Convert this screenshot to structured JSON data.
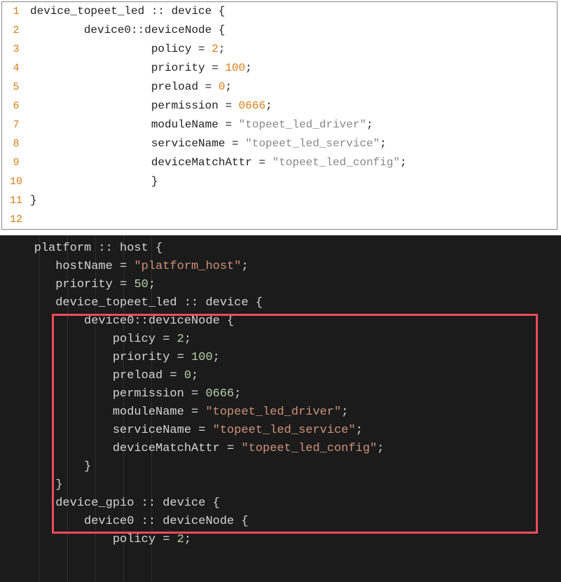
{
  "light": {
    "gutter": [
      "1",
      "2",
      "3",
      "4",
      "5",
      "6",
      "7",
      "8",
      "9",
      "10",
      "11",
      "12"
    ],
    "lines": [
      [
        {
          "t": "device_topeet_led :: device {"
        }
      ],
      [
        {
          "t": "        device0::deviceNode {"
        }
      ],
      [
        {
          "t": "                  policy = "
        },
        {
          "t": "2",
          "c": "num"
        },
        {
          "t": ";"
        }
      ],
      [
        {
          "t": "                  priority = "
        },
        {
          "t": "100",
          "c": "num"
        },
        {
          "t": ";"
        }
      ],
      [
        {
          "t": "                  preload = "
        },
        {
          "t": "0",
          "c": "num"
        },
        {
          "t": ";"
        }
      ],
      [
        {
          "t": "                  permission = "
        },
        {
          "t": "0666",
          "c": "num"
        },
        {
          "t": ";"
        }
      ],
      [
        {
          "t": "                  moduleName = "
        },
        {
          "t": "\"topeet_led_driver\"",
          "c": "str"
        },
        {
          "t": ";"
        }
      ],
      [
        {
          "t": "                  serviceName = "
        },
        {
          "t": "\"topeet_led_service\"",
          "c": "str"
        },
        {
          "t": ";"
        }
      ],
      [
        {
          "t": "                  deviceMatchAttr = "
        },
        {
          "t": "\"topeet_led_config\"",
          "c": "str"
        },
        {
          "t": ";"
        }
      ],
      [
        {
          "t": ""
        }
      ],
      [
        {
          "t": "                  }"
        }
      ],
      [
        {
          "t": "}"
        }
      ]
    ]
  },
  "dark": {
    "rulers": [
      56,
      96,
      136,
      176,
      216
    ],
    "lines": [
      [
        {
          "t": "   platform :: host {"
        }
      ],
      [
        {
          "t": "      hostName = "
        },
        {
          "t": "\"platform_host\"",
          "c": "dstr"
        },
        {
          "t": ";"
        }
      ],
      [
        {
          "t": "      priority = "
        },
        {
          "t": "50",
          "c": "dnum"
        },
        {
          "t": ";"
        }
      ],
      [
        {
          "t": ""
        }
      ],
      [
        {
          "t": "      device_topeet_led :: device {"
        }
      ],
      [
        {
          "t": "          device0::deviceNode {"
        }
      ],
      [
        {
          "t": "              policy = "
        },
        {
          "t": "2",
          "c": "dnum"
        },
        {
          "t": ";"
        }
      ],
      [
        {
          "t": "              priority = "
        },
        {
          "t": "100",
          "c": "dnum"
        },
        {
          "t": ";"
        }
      ],
      [
        {
          "t": "              preload = "
        },
        {
          "t": "0",
          "c": "dnum"
        },
        {
          "t": ";"
        }
      ],
      [
        {
          "t": "              permission = "
        },
        {
          "t": "0666",
          "c": "dnum"
        },
        {
          "t": ";"
        }
      ],
      [
        {
          "t": "              moduleName = "
        },
        {
          "t": "\"topeet_led_driver\"",
          "c": "dstr"
        },
        {
          "t": ";"
        }
      ],
      [
        {
          "t": "              serviceName = "
        },
        {
          "t": "\"topeet_led_service\"",
          "c": "dstr"
        },
        {
          "t": ";"
        }
      ],
      [
        {
          "t": "              deviceMatchAttr = "
        },
        {
          "t": "\"topeet_led_config\"",
          "c": "dstr"
        },
        {
          "t": ";"
        }
      ],
      [
        {
          "t": ""
        }
      ],
      [
        {
          "t": "          }"
        }
      ],
      [
        {
          "t": "      }"
        }
      ],
      [
        {
          "t": ""
        }
      ],
      [
        {
          "t": "      device_gpio :: device {"
        }
      ],
      [
        {
          "t": "          device0 :: deviceNode {"
        }
      ],
      [
        {
          "t": "              policy = "
        },
        {
          "t": "2",
          "c": "dnum"
        },
        {
          "t": ";"
        }
      ]
    ]
  }
}
